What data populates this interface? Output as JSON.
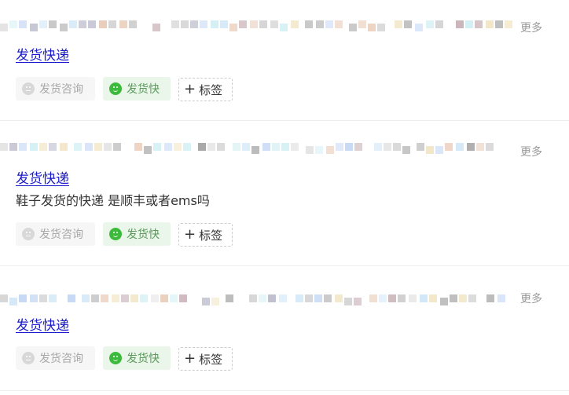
{
  "results": [
    {
      "more_label": "更多",
      "title": "发货快递",
      "description": "",
      "tags": {
        "consult": "发货咨询",
        "fast": "发货快",
        "add": "标签"
      }
    },
    {
      "more_label": "更多",
      "title": "发货快递",
      "description": "鞋子发货的快递 是顺丰或者ems吗",
      "tags": {
        "consult": "发货咨询",
        "fast": "发货快",
        "add": "标签"
      }
    },
    {
      "more_label": "更多",
      "title": "发货快递",
      "description": "",
      "tags": {
        "consult": "发货咨询",
        "fast": "发货快",
        "add": "标签"
      }
    }
  ],
  "plus_glyph": "+",
  "colors": {
    "link": "#1a1acc",
    "more": "#999999",
    "fast_bg": "#eaf6ea",
    "fast_icon": "#3cba3c",
    "consult_bg": "#f6f6f6"
  }
}
